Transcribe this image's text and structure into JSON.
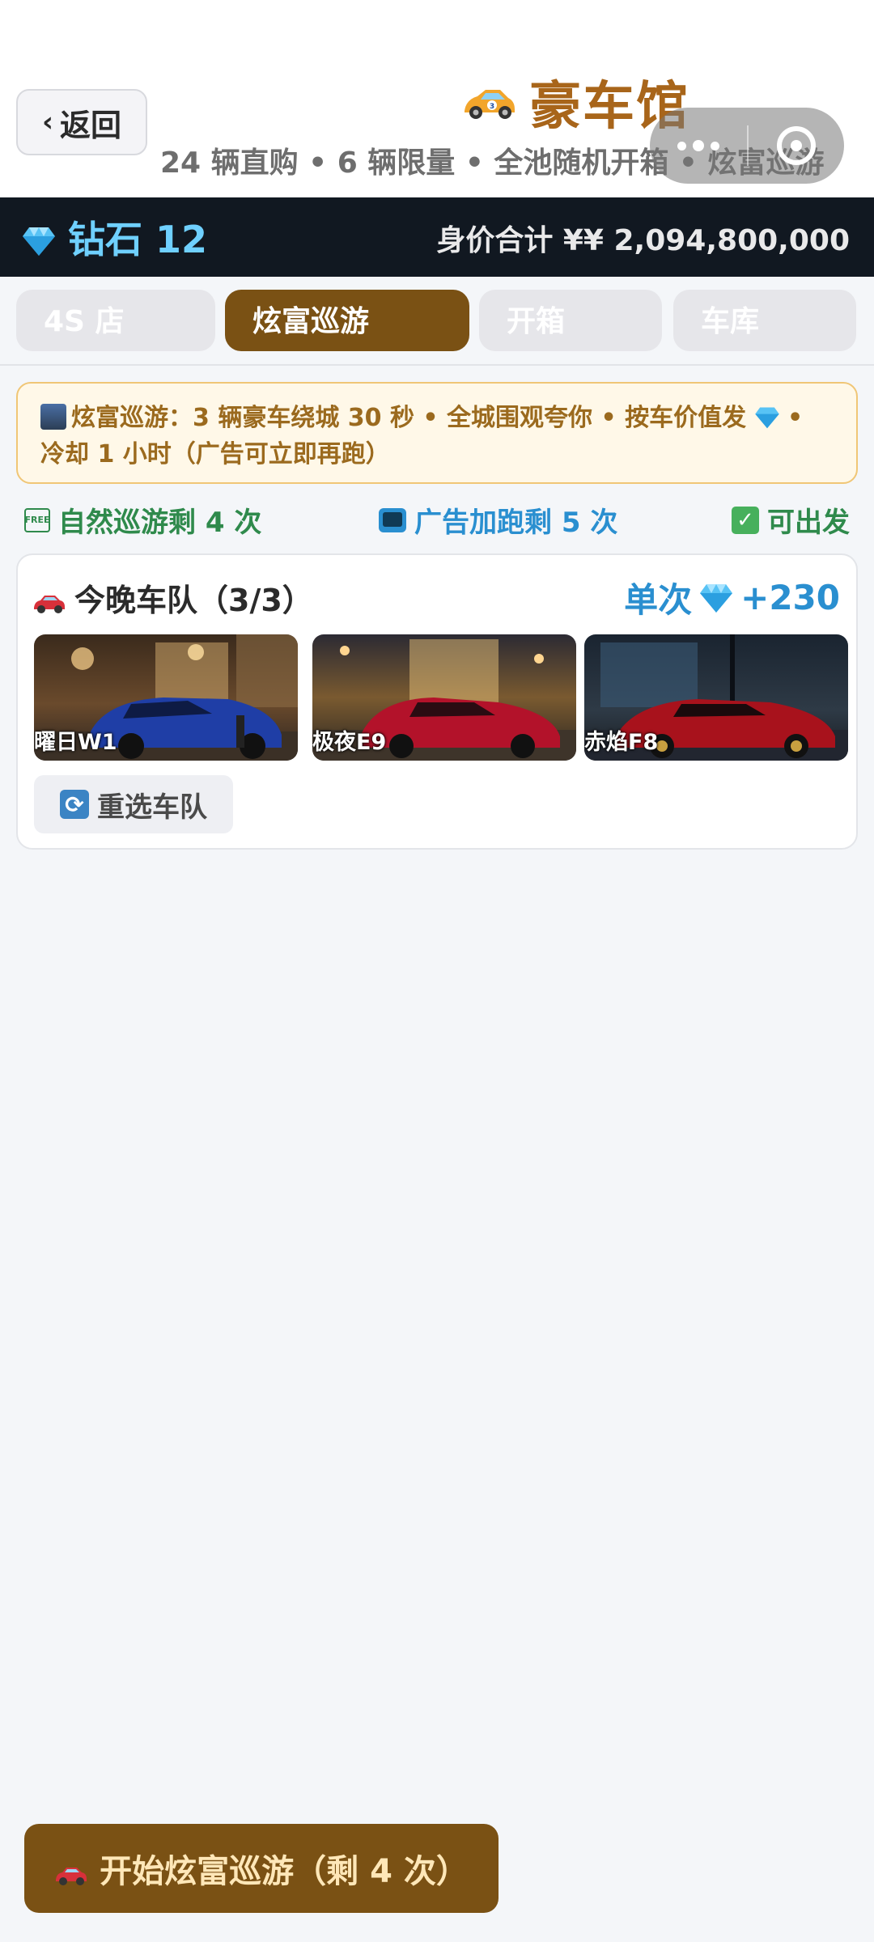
{
  "header": {
    "back_label": "返回",
    "title": "豪车馆",
    "subtitle": "24 辆直购 • 6 辆限量 • 全池随机开箱 • 炫富巡游"
  },
  "wallet": {
    "diamonds_label": "钻石 12",
    "networth_label": "身价合计 ¥¥ 2,094,800,000"
  },
  "tabs": [
    {
      "label": "4S 店",
      "active": false
    },
    {
      "label": "炫富巡游",
      "active": true
    },
    {
      "label": "开箱",
      "active": false
    },
    {
      "label": "车库",
      "active": false
    }
  ],
  "banner": {
    "line1": "炫富巡游：3 辆豪车绕城 30 秒 • 全城围观夸你 • 按车价值发",
    "line1_tail": " •",
    "line2": "冷却 1 小时（广告可立即再跑）"
  },
  "status": {
    "free_runs": "自然巡游剩 4 次",
    "ad_runs": "广告加跑剩 5 次",
    "ready": "可出发"
  },
  "fleet": {
    "title": "今晚车队（3/3）",
    "reward_prefix": "单次",
    "reward_value": "+230",
    "cars": [
      {
        "name": "曜日W1",
        "color": "#2b4fb8"
      },
      {
        "name": "极夜E9",
        "color": "#b3122a"
      },
      {
        "name": "赤焰F8",
        "color": "#a8121c"
      }
    ],
    "reselect_label": "重选车队"
  },
  "footer": {
    "start_label": "开始炫富巡游（剩 4 次）"
  }
}
